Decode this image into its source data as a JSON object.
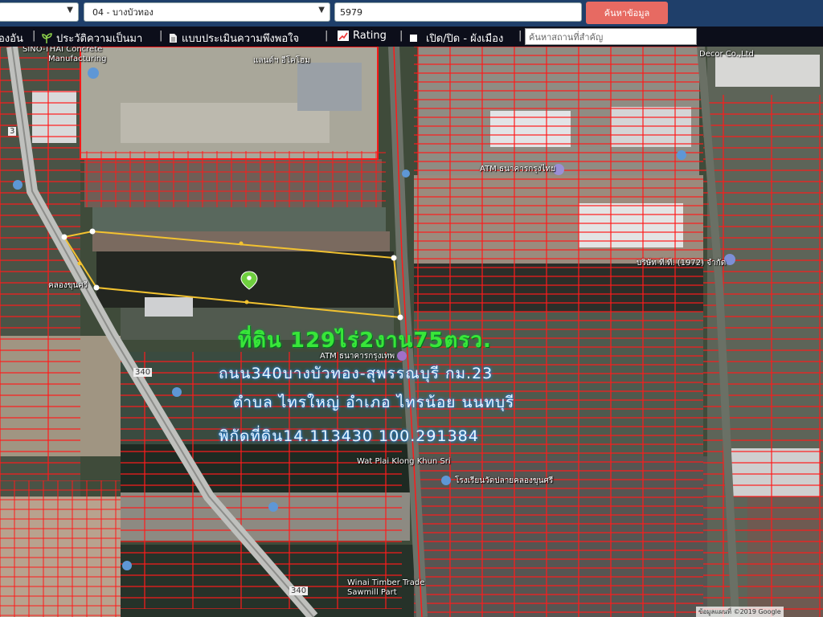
{
  "topbar": {
    "select1_value": "",
    "select2_value": "04 - บางบัวทอง",
    "search_value": "5979",
    "search_button": "ค้นหาข้อมูล"
  },
  "navbar": {
    "item1": "องอัน",
    "item2": "ประวัติความเป็นมา",
    "item3": "แบบประเมินความพึงพอใจ",
    "item4": "Rating",
    "item5": "เปิด/ปิด - ผังเมือง",
    "search_placeholder": "ค้นหาสถานที่สำคัญ"
  },
  "map": {
    "headline": "ที่ดิน 129ไร่2งาน75ตรว.",
    "line2": "ถนน340บางบัวทอง-สุพรรณบุรี กม.23",
    "line3": "ตำบล ไทรใหญ่ อำเภอ ไทรน้อย นนทบุรี",
    "line4": "พิกัดที่ดิน14.113430  100.291384",
    "labels": {
      "sino": "SINO-THAI Concrete",
      "manuf": "Manufacturing",
      "factory": "แลนด์ฯ อีโคโฮม",
      "decor": "Decor Co.,Ltd",
      "atm1": "ATM ธนาคารกรุงไทย",
      "company1": "บริษัท ที.ที. (1972) จำกัด",
      "atm2": "ATM ธนาคารกรุงเทพ",
      "wat": "Wat Plai Klong Khun Sri",
      "school": "โรงเรียนวัดปลายคลองขุนศรี",
      "timber": "Winai Timber Trade",
      "sawmill": "Sawmill Part",
      "khlong": "คลองขุนศรี",
      "road340a": "340",
      "road340b": "340",
      "road3": "3",
      "footer": "ข้อมูลแผนที่ ©2019 Google"
    }
  },
  "colors": {
    "topbar": "#1f3f6a",
    "navbar": "#0c0e1a",
    "button": "#e76a62",
    "parcel_lines": "#ff1a1a",
    "highlight_border": "#f2c230",
    "headline": "#39e639"
  }
}
